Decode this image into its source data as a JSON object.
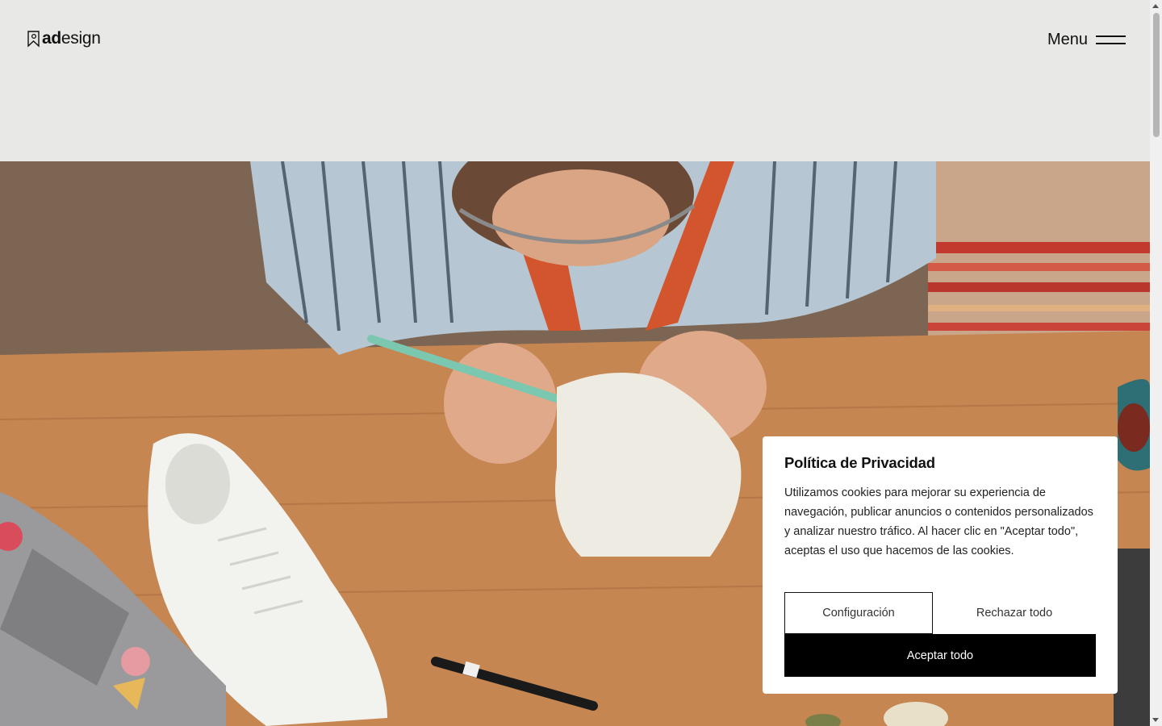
{
  "header": {
    "logo": {
      "bold": "ad",
      "light": "esign",
      "icon": "bookmark-pin-icon"
    },
    "menu_label": "Menu",
    "menu_icon": "hamburger-icon"
  },
  "hero": {
    "image": "designer-painting-white-sneaker-photo"
  },
  "cookie_banner": {
    "title": "Política de Privacidad",
    "text": "Utilizamos cookies para mejorar su experiencia de navegación, publicar anuncios o contenidos personalizados y analizar nuestro tráfico. Al hacer clic en \"Aceptar todo\", aceptas el uso que hacemos de las cookies.",
    "config_label": "Configuración",
    "reject_label": "Rechazar todo",
    "accept_label": "Aceptar todo"
  },
  "colors": {
    "background": "#e8e8e6",
    "accent": "#000000"
  }
}
